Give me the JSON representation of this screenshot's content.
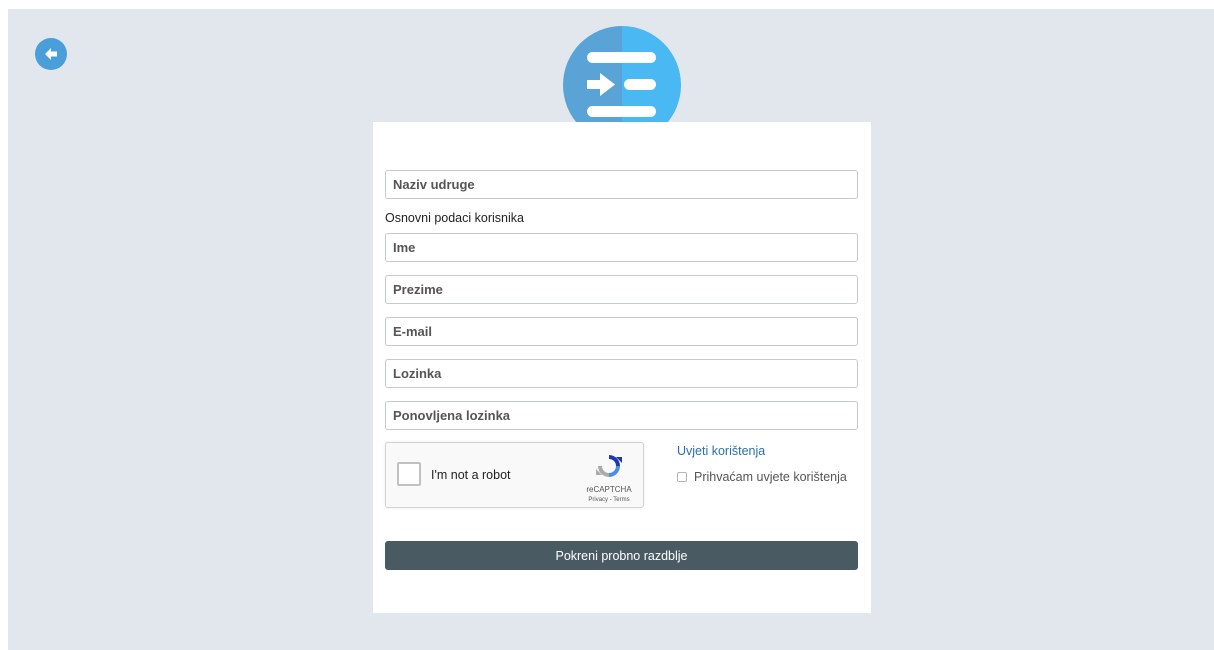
{
  "header": {
    "back_icon": "arrow-left-circle-icon",
    "logo_icon": "sign-in-list-logo-icon",
    "colors": {
      "logo_left": "#5aa3d6",
      "logo_right": "#4ab8f2",
      "back": "#4a9fdb"
    }
  },
  "form": {
    "org_name_placeholder": "Naziv udruge",
    "section_label": "Osnovni podaci korisnika",
    "first_name_placeholder": "Ime",
    "last_name_placeholder": "Prezime",
    "email_placeholder": "E-mail",
    "password_placeholder": "Lozinka",
    "password_repeat_placeholder": "Ponovljena lozinka"
  },
  "captcha": {
    "label": "I'm not a robot",
    "brand": "reCAPTCHA",
    "links": "Privacy - Terms"
  },
  "terms": {
    "link_label": "Uvjeti korištenja",
    "accept_label": "Prihvaćam uvjete korištenja"
  },
  "submit": {
    "label": "Pokreni probno razdblje",
    "color": "#4a5a63"
  }
}
